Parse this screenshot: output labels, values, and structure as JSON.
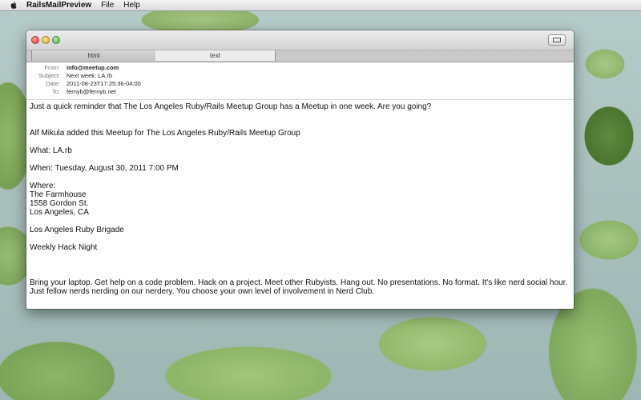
{
  "menubar": {
    "app_name": "RailsMailPreview",
    "menus": [
      "File",
      "Help"
    ]
  },
  "window": {
    "tabs": [
      {
        "label": "html",
        "selected": false
      },
      {
        "label": "text",
        "selected": true
      }
    ],
    "headers": [
      {
        "label": "From:",
        "value": "info@meetup.com"
      },
      {
        "label": "Subject:",
        "value": "Next week: LA.rb"
      },
      {
        "label": "Date:",
        "value": "2011-08-23T17:25:36-04:00"
      },
      {
        "label": "To:",
        "value": "fernyb@fernyb.net"
      }
    ],
    "body": {
      "line1": "Just a quick reminder that The Los Angeles Ruby/Rails Meetup Group has a Meetup in one week. Are you going?",
      "line2": "Alf Mikula added this Meetup for The Los Angeles Ruby/Rails Meetup Group",
      "what": "What: LA.rb",
      "when": "When: Tuesday, August 30, 2011 7:00 PM",
      "where_label": "Where:",
      "where_name": "The Farmhouse",
      "where_street": "1558 Gordon St.",
      "where_city": "Los Angeles, CA",
      "group": "Los Angeles Ruby Brigade",
      "event": "Weekly Hack Night",
      "desc1": "Bring your laptop. Get help on a code problem. Hack on a project. Meet other Rubyists. Hang out. No presentations. No format. It's like nerd social hour.",
      "desc2": "Just fellow nerds nerding on our nerdery. You choose your own level of involvement in Nerd Club."
    }
  }
}
